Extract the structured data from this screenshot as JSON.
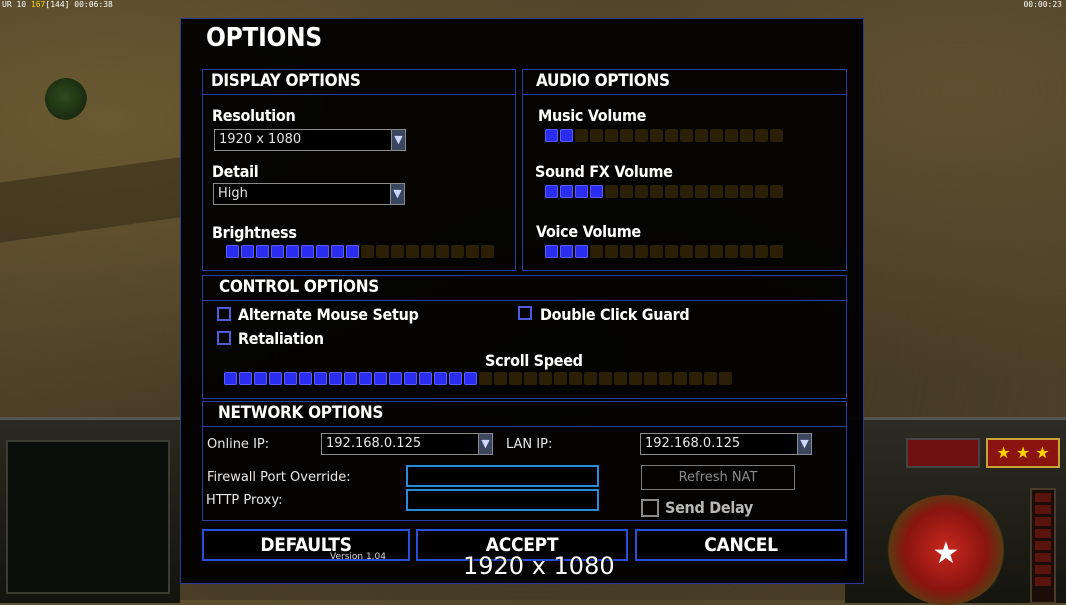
{
  "hud": {
    "top_left_prefix": "UR 10",
    "top_left_res": "167",
    "top_left_bracket": "[144]",
    "top_left_time": "00:06:38",
    "top_right_time": "00:00:23",
    "rank_stars": "★ ★ ★"
  },
  "dialog": {
    "title": "OPTIONS",
    "display": {
      "header": "DISPLAY OPTIONS",
      "resolution_label": "Resolution",
      "resolution_value": "1920 x 1080",
      "detail_label": "Detail",
      "detail_value": "High",
      "brightness_label": "Brightness",
      "brightness_level": 0.5
    },
    "audio": {
      "header": "AUDIO OPTIONS",
      "music_label": "Music Volume",
      "music_level": 0.125,
      "sfx_label": "Sound FX Volume",
      "sfx_level": 0.25,
      "voice_label": "Voice Volume",
      "voice_level": 0.1875
    },
    "control": {
      "header": "CONTROL OPTIONS",
      "alt_mouse_label": "Alternate Mouse Setup",
      "alt_mouse_checked": false,
      "retaliation_label": "Retaliation",
      "retaliation_checked": false,
      "double_click_label": "Double Click Guard",
      "double_click_checked": false,
      "scroll_label": "Scroll Speed",
      "scroll_level": 0.5
    },
    "network": {
      "header": "NETWORK OPTIONS",
      "online_ip_label": "Online IP:",
      "online_ip_value": "192.168.0.125",
      "lan_ip_label": "LAN IP:",
      "lan_ip_value": "192.168.0.125",
      "firewall_label": "Firewall Port Override:",
      "firewall_value": "",
      "http_proxy_label": "HTTP Proxy:",
      "http_proxy_value": "",
      "refresh_nat_label": "Refresh NAT",
      "send_delay_label": "Send Delay",
      "send_delay_checked": false
    },
    "buttons": {
      "defaults": "DEFAULTS",
      "accept": "ACCEPT",
      "cancel": "CANCEL"
    },
    "version": "Version 1.04"
  },
  "overlay_resolution": "1920 x 1080",
  "colors": {
    "accent_blue": "#2a2cf0",
    "panel_border": "#2b3fa0",
    "slider_off": "#2b1f05"
  }
}
